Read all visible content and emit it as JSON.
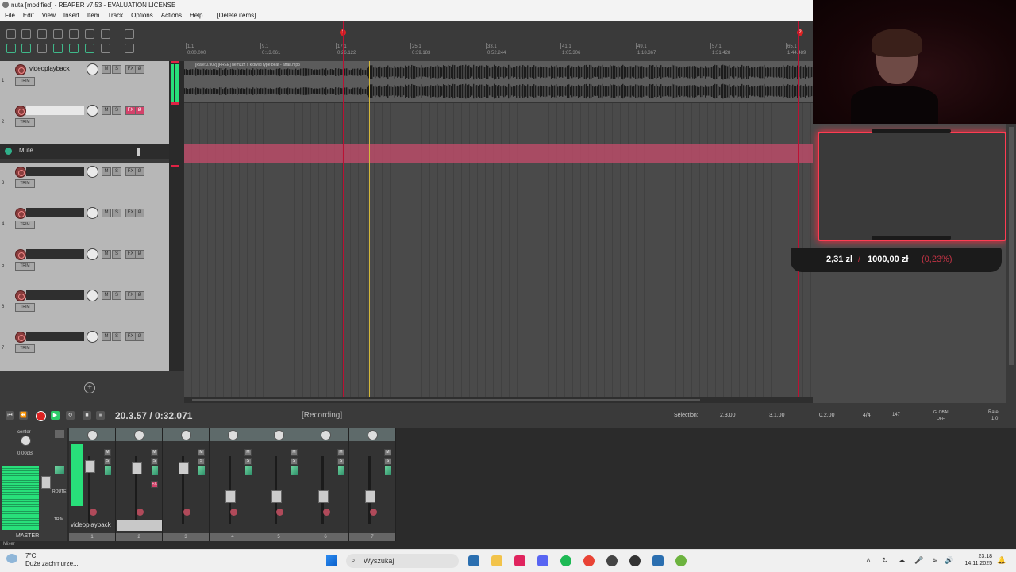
{
  "window": {
    "title": "nuta [modified] - REAPER v7.53 - EVALUATION LICENSE"
  },
  "menu": [
    "File",
    "Edit",
    "View",
    "Insert",
    "Item",
    "Track",
    "Options",
    "Actions",
    "Help",
    "[Delete items]"
  ],
  "ruler": {
    "markers": [
      "1",
      "2"
    ],
    "bars": [
      "1.1",
      "9.1",
      "17.1",
      "25.1",
      "33.1",
      "41.1",
      "49.1",
      "57.1",
      "65.1"
    ],
    "times": [
      "0:00.000",
      "0:13.061",
      "0:26.122",
      "0:39.183",
      "0:52.244",
      "1:05.306",
      "1:18.367",
      "1:31.428",
      "1:44.489"
    ]
  },
  "tracks": [
    {
      "num": "1",
      "name": "videoplayback",
      "trim": "TRIM"
    },
    {
      "num": "2",
      "name": "",
      "trim": "TRIM"
    },
    {
      "num": "3",
      "name": "",
      "trim": "TRIM"
    },
    {
      "num": "4",
      "name": "",
      "trim": "TRIM"
    },
    {
      "num": "5",
      "name": "",
      "trim": "TRIM"
    },
    {
      "num": "6",
      "name": "",
      "trim": "TRIM"
    },
    {
      "num": "7",
      "name": "",
      "trim": "TRIM"
    }
  ],
  "track_buttons": {
    "m": "M",
    "s": "S",
    "fx": "FX",
    "o": "Ø"
  },
  "envelope": {
    "label": "Mute"
  },
  "item": {
    "label": "[Rate:0.902] [FREE] nemzzz x kidwild type beat - affair.mp3"
  },
  "transport": {
    "time": "20.3.57 / 0:32.071",
    "state": "[Recording]",
    "selection_label": "Selection:",
    "sel_start": "2.3.00",
    "sel_end": "3.1.00",
    "sel_len": "0.2.00",
    "timesig": "4/4",
    "bpm": "147",
    "rate_label": "Rate:",
    "rate": "1.0",
    "global_label": "GLOBAL",
    "global_state": "OFF"
  },
  "mixer": {
    "master_label": "MASTER",
    "master_pan": "center",
    "master_vol": "0.00dB",
    "tab_label": "Mixer",
    "strip_name": "videoplayback",
    "strip_nums": [
      "1",
      "2",
      "3",
      "4",
      "5",
      "6",
      "7"
    ],
    "route_label": "ROUTE",
    "trim_label": "TRIM"
  },
  "overlay": {
    "current": "2,31 zł",
    "separator": "/",
    "goal": "1000,00 zł",
    "percent": "(0,23%)"
  },
  "taskbar": {
    "temperature": "7°C",
    "condition": "Duże zachmurze...",
    "search_placeholder": "Wyszukaj",
    "time": "23:18",
    "date": "14.11.2025"
  },
  "colors": {
    "accent_red": "#ff3c52",
    "envelope": "#b94b67",
    "meter_green": "#28e07a",
    "play_green": "#2dcc6a"
  }
}
